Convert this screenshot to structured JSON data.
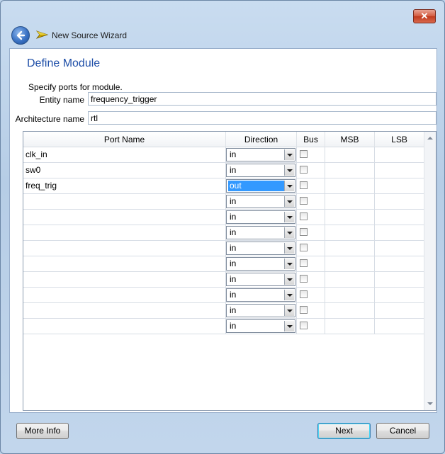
{
  "window": {
    "title": "New Source Wizard",
    "close_glyph": "✕"
  },
  "page": {
    "title": "Define Module",
    "prompt": "Specify ports for module."
  },
  "form": {
    "entity_label": "Entity name",
    "entity_value": "frequency_trigger",
    "arch_label": "Architecture name",
    "arch_value": "rtl"
  },
  "table": {
    "headers": {
      "port_name": "Port Name",
      "direction": "Direction",
      "bus": "Bus",
      "msb": "MSB",
      "lsb": "LSB"
    },
    "rows": [
      {
        "name": "clk_in",
        "direction": "in",
        "bus": false,
        "msb": "",
        "lsb": ""
      },
      {
        "name": "sw0",
        "direction": "in",
        "bus": false,
        "msb": "",
        "lsb": ""
      },
      {
        "name": "freq_trig",
        "direction": "out",
        "bus": false,
        "msb": "",
        "lsb": "",
        "selected": true
      },
      {
        "name": "",
        "direction": "in",
        "bus": false,
        "msb": "",
        "lsb": ""
      },
      {
        "name": "",
        "direction": "in",
        "bus": false,
        "msb": "",
        "lsb": ""
      },
      {
        "name": "",
        "direction": "in",
        "bus": false,
        "msb": "",
        "lsb": ""
      },
      {
        "name": "",
        "direction": "in",
        "bus": false,
        "msb": "",
        "lsb": ""
      },
      {
        "name": "",
        "direction": "in",
        "bus": false,
        "msb": "",
        "lsb": ""
      },
      {
        "name": "",
        "direction": "in",
        "bus": false,
        "msb": "",
        "lsb": ""
      },
      {
        "name": "",
        "direction": "in",
        "bus": false,
        "msb": "",
        "lsb": ""
      },
      {
        "name": "",
        "direction": "in",
        "bus": false,
        "msb": "",
        "lsb": ""
      },
      {
        "name": "",
        "direction": "in",
        "bus": false,
        "msb": "",
        "lsb": ""
      }
    ]
  },
  "buttons": {
    "more_info": "More Info",
    "next": "Next",
    "cancel": "Cancel"
  },
  "icons": {
    "back": "back-arrow-icon",
    "wizard": "wizard-wand-icon",
    "close": "close-icon"
  },
  "colors": {
    "title_blue": "#1f4fa8",
    "selection": "#3399ff",
    "close_red": "#c03a1e"
  }
}
